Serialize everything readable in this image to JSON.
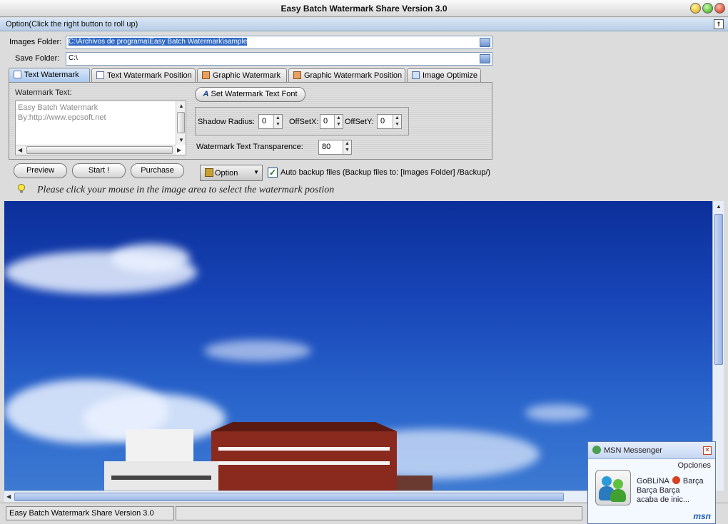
{
  "window": {
    "title": "Easy Batch Watermark Share Version 3.0"
  },
  "option_bar": {
    "label": "Option(Click the right button to roll up)",
    "rollup_glyph": "⇑"
  },
  "folders": {
    "images_label": "Images Folder:",
    "images_value": "C:\\Archivos de programa\\Easy Batch Watermark\\sample",
    "save_label": "Save Folder:",
    "save_value": "C:\\"
  },
  "tabs": [
    {
      "label": "Text  Watermark",
      "active": true
    },
    {
      "label": "Text Watermark Position",
      "active": false
    },
    {
      "label": "Graphic Watermark",
      "active": false
    },
    {
      "label": "Graphic Watermark Position",
      "active": false
    },
    {
      "label": "Image Optimize",
      "active": false
    }
  ],
  "panel": {
    "watermark_text_label": "Watermark Text:",
    "watermark_text_lines": [
      "Easy Batch Watermark",
      "By:http://www.epcsoft.net"
    ],
    "set_font_button": "Set Watermark Text Font",
    "shadow_radius_label": "Shadow Radius:",
    "shadow_radius_value": "0",
    "offset_x_label": "OffSetX:",
    "offset_x_value": "0",
    "offset_y_label": "OffSetY:",
    "offset_y_value": "0",
    "transparence_label": "Watermark Text Transparence:",
    "transparence_value": "80"
  },
  "actions": {
    "preview": "Preview",
    "start": "Start !",
    "purchase": "Purchase",
    "option": "Option",
    "auto_backup_label": "Auto backup files (Backup files to: [Images Folder] /Backup/)",
    "auto_backup_checked": true
  },
  "hint": "Please click your mouse in the image area to select the watermark postion",
  "status": {
    "text": "Easy Batch Watermark Share Version 3.0"
  },
  "msn_popup": {
    "title": "MSN Messenger",
    "options": "Opciones",
    "line1_name": "GoBLiNA",
    "line1_after": "Barça",
    "line2": "Barça Barça",
    "line3": "acaba de inic...",
    "logo": "msn"
  },
  "colors": {
    "accent": "#316ac5",
    "sky": "#1846b8"
  }
}
